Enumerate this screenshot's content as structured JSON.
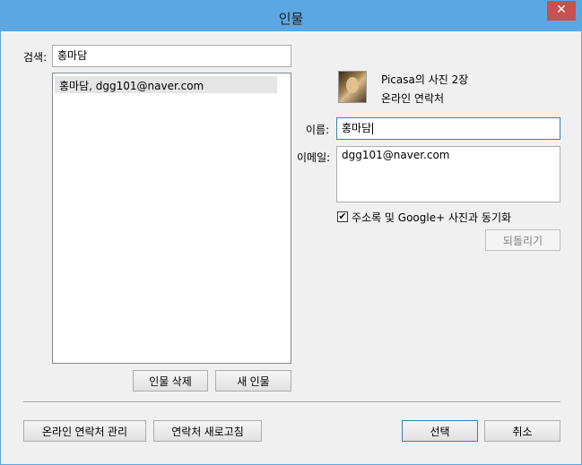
{
  "window": {
    "title": "인물",
    "close_glyph": "✕"
  },
  "search": {
    "label": "검색:",
    "value": "홍마담"
  },
  "people_list": {
    "items": [
      {
        "label": "홍마담, dgg101@naver.com"
      }
    ]
  },
  "profile": {
    "photo_count": "Picasa의 사진 2장",
    "contact_type": "온라인 연락처"
  },
  "name_field": {
    "label": "이름:",
    "value": "홍마담"
  },
  "email_field": {
    "label": "이메일:",
    "value": "dgg101@naver.com"
  },
  "sync": {
    "label": "주소록 및 Google+ 사진과 동기화",
    "checked": true,
    "check_glyph": "✔"
  },
  "buttons": {
    "revert": "되돌리기",
    "delete_person": "인물 삭제",
    "new_person": "새 인물",
    "manage_online_contacts": "온라인 연락처 관리",
    "refresh_contacts": "연락처 새로고침",
    "select": "선택",
    "cancel": "취소"
  }
}
